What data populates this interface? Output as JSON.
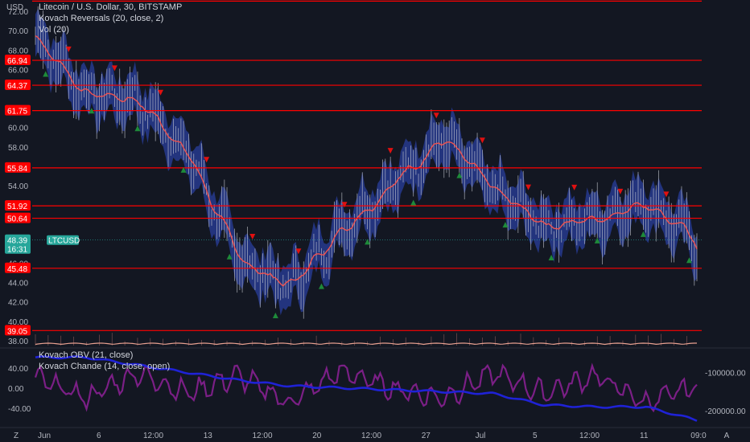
{
  "legend": {
    "symbol_line": "Litecoin / U.S. Dollar, 30, BITSTAMP",
    "kovach_reversals": "Kovach Reversals (20, close, 2)",
    "vol": "Vol (20)",
    "kovach_obv": "Kovach OBV (21, close)",
    "kovach_chande": "Kovach Chande (14, close, open)"
  },
  "currency": "USD",
  "ticker": "LTCUSD",
  "current_price": "48.39",
  "countdown": "16:31",
  "price_axis": {
    "min": 37.5,
    "max": 73.0,
    "ticks": [
      "72.00",
      "70.00",
      "68.00",
      "66.00",
      "62.00",
      "60.00",
      "58.00",
      "54.00",
      "52.00",
      "48.00",
      "46.00",
      "44.00",
      "42.00",
      "40.00",
      "38.00"
    ]
  },
  "horizontal_lines": [
    {
      "label": "",
      "value": 73.05
    },
    {
      "label": "66.94",
      "value": 66.94
    },
    {
      "label": "64.37",
      "value": 64.37
    },
    {
      "label": "61.75",
      "value": 61.75
    },
    {
      "label": "55.84",
      "value": 55.84
    },
    {
      "label": "51.92",
      "value": 51.92
    },
    {
      "label": "50.64",
      "value": 50.64
    },
    {
      "label": "45.48",
      "value": 45.48
    },
    {
      "label": "39.05",
      "value": 39.05
    }
  ],
  "time_axis": [
    "Jun",
    "6",
    "12:00",
    "13",
    "12:00",
    "20",
    "12:00",
    "27",
    "Jul",
    "5",
    "12:00",
    "11",
    "09:0"
  ],
  "chande_axis": [
    "40.00",
    "0.00",
    "-40.00"
  ],
  "obv_axis": [
    "-100000.00",
    "-200000.00"
  ],
  "timezone_icon": "Z",
  "settings_icon": "A",
  "colors": {
    "background": "#131722",
    "line": "#ff0000",
    "ma": "#ef5350",
    "band": "#2a3f9e",
    "up_arrow": "#1e8a3a",
    "down_arrow": "#e01010",
    "obv": "#1f22d6",
    "chande": "#7b1f86",
    "price_label": "#26a69a"
  },
  "chart_data": [
    {
      "type": "line",
      "name_text": "Litecoin / U.S. Dollar",
      "x": [
        "Jun",
        "6",
        "12:00",
        "13",
        "12:00",
        "20",
        "12:00",
        "27",
        "Jul",
        "5",
        "12:00",
        "11",
        "09:0"
      ],
      "series": [
        {
          "name": "LTCUSD",
          "values": [
            69.5,
            63.5,
            63.0,
            57.5,
            46.5,
            43.5,
            49.5,
            54.0,
            59.0,
            53.5,
            50.0,
            50.5,
            52.5,
            48.2
          ]
        }
      ],
      "ylim": [
        37.5,
        73.0
      ]
    },
    {
      "type": "line",
      "series": [
        {
          "name": "Kovach OBV",
          "values": [
            -60000,
            -60000,
            -80000,
            -100000,
            -120000,
            -135000,
            -140000,
            -145000,
            -150000,
            -155000,
            -185000,
            -190000,
            -190000,
            -225000
          ]
        },
        {
          "name": "Kovach Chande",
          "values": [
            20,
            -20,
            30,
            -10,
            25,
            -30,
            35,
            0,
            -20,
            30,
            -10,
            25,
            -30,
            5
          ]
        }
      ]
    }
  ]
}
